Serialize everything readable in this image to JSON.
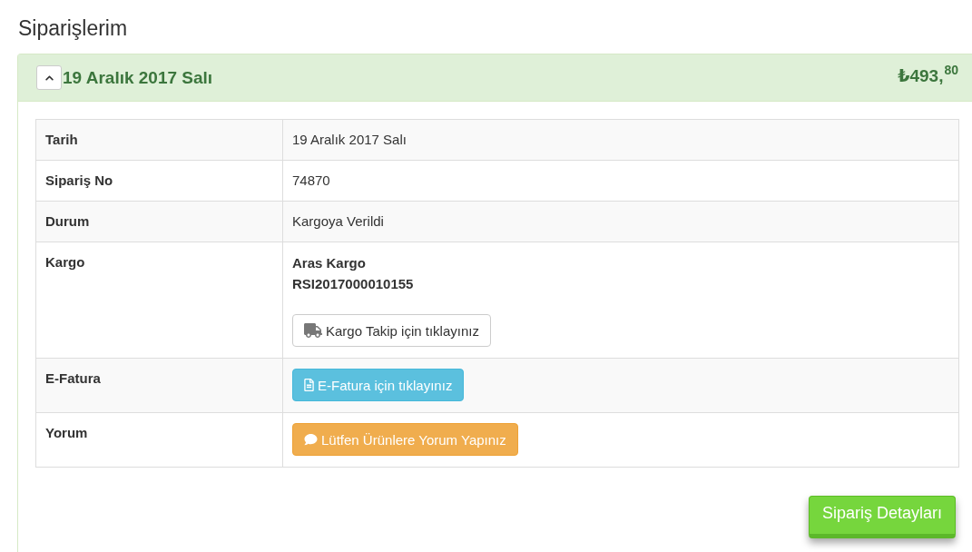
{
  "page": {
    "title": "Siparişlerim"
  },
  "order": {
    "expanded": true,
    "date": "19 Aralık 2017 Salı",
    "total": "₺493,$^{80}$",
    "rows": [
      {
        "label": "Tarih",
        "kind": "text",
        "value": "19 Aralık 2017 Salı"
      },
      {
        "label": "Sipariş No",
        "kind": "text",
        "value": "74870"
      },
      {
        "label": "Durum",
        "kind": "text",
        "value": "Kargoya Verildi"
      },
      {
        "label": "Kargo",
        "kind": "cargo",
        "company": "Aras Kargo",
        "tracking_no": "RSI2017000010155",
        "button": {
          "kind": "default",
          "label": "Kargo Takip için tıklayınız"
        }
      },
      {
        "label": "E-Fatura",
        "kind": "button",
        "button": {
          "kind": "info",
          "label": "E-Fatura için tıklayınız"
        }
      },
      {
        "label": "Yorum",
        "kind": "button",
        "button": {
          "kind": "warning",
          "label": "Lütfen Ürünlere Yorum Yapınız"
        }
      }
    ],
    "details_button": {
      "label": "Sipariş Detayları"
    }
  }
}
